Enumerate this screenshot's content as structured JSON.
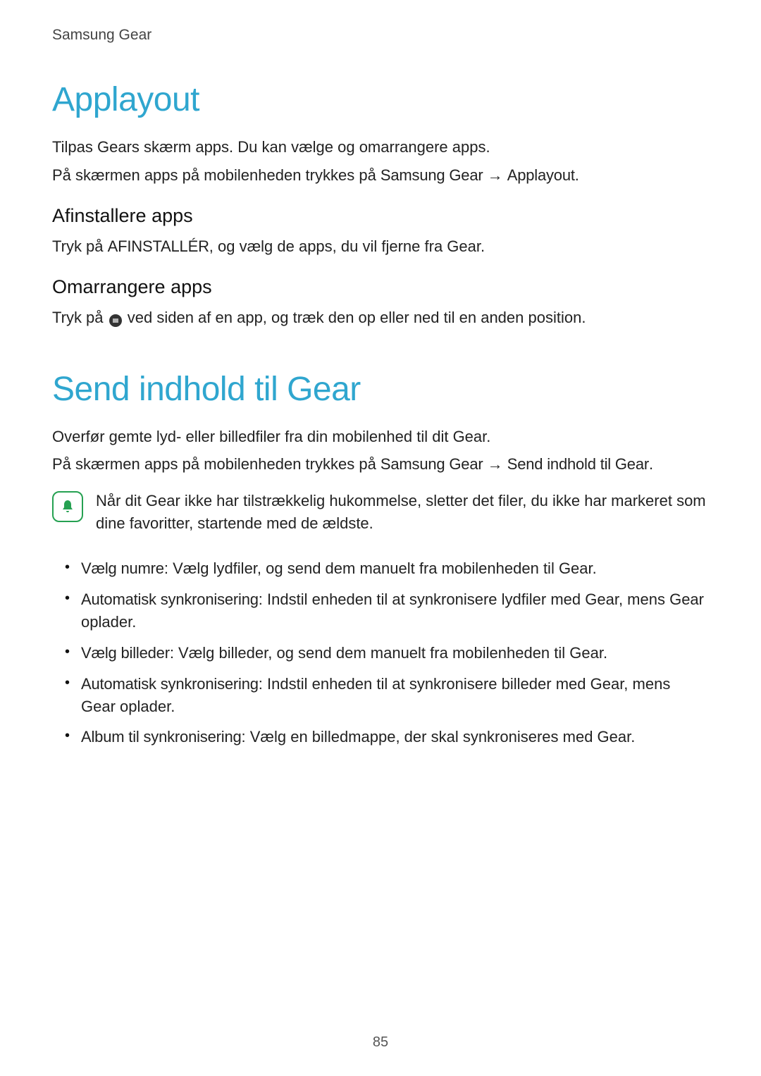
{
  "header": {
    "breadcrumb": "Samsung Gear"
  },
  "s1": {
    "title": "Applayout",
    "p1a": "Tilpas Gears skærm apps. Du kan vælge og omarrangere apps.",
    "p1b_pre": "På skærmen apps på mobilenheden trykkes på ",
    "p1b_b1": "Samsung Gear",
    "p1b_mid": " → ",
    "p1b_b2": "Applayout",
    "p1b_post": ".",
    "h2a": "Afinstallere apps",
    "p2a_pre": "Tryk på ",
    "p2a_b": "AFINSTALLÉR",
    "p2a_post": ", og vælg de apps, du vil fjerne fra Gear.",
    "h2b": "Omarrangere apps",
    "p2b_pre": "Tryk på ",
    "p2b_post": " ved siden af en app, og træk den op eller ned til en anden position."
  },
  "s2": {
    "title": "Send indhold til Gear",
    "p1": "Overfør gemte lyd- eller billedfiler fra din mobilenhed til dit Gear.",
    "p2_pre": "På skærmen apps på mobilenheden trykkes på ",
    "p2_b1": "Samsung Gear",
    "p2_mid": " → ",
    "p2_b2": "Send indhold til Gear",
    "p2_post": ".",
    "note": "Når dit Gear ikke har tilstrækkelig hukommelse, sletter det filer, du ikke har markeret som dine favoritter, startende med de ældste.",
    "items": [
      {
        "b": "Vælg numre",
        "t": ": Vælg lydfiler, og send dem manuelt fra mobilenheden til Gear."
      },
      {
        "b": "Automatisk synkronisering",
        "t": ": Indstil enheden til at synkronisere lydfiler med Gear, mens Gear oplader."
      },
      {
        "b": "Vælg billeder",
        "t": ": Vælg billeder, og send dem manuelt fra mobilenheden til Gear."
      },
      {
        "b": "Automatisk synkronisering",
        "t": ": Indstil enheden til at synkronisere billeder med Gear, mens Gear oplader."
      },
      {
        "b": "Album til synkronisering",
        "t": ": Vælg en billedmappe, der skal synkroniseres med Gear."
      }
    ]
  },
  "page_number": "85",
  "icons": {
    "bell": "bell-icon",
    "drag": "drag-handle-icon"
  }
}
